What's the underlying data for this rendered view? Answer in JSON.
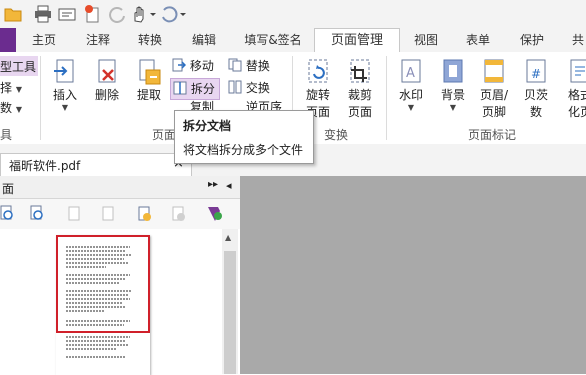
{
  "colors": {
    "accent": "#6b2c8f",
    "highlight": "#e8d6f0",
    "thumb_border": "#d0202a"
  },
  "qat": {
    "icons": [
      "folder-icon",
      "print-icon",
      "scan-icon",
      "new-icon",
      "redo-disabled-icon",
      "hand-tool-icon",
      "undo-icon"
    ]
  },
  "tabs": [
    {
      "label": "主页"
    },
    {
      "label": "注释"
    },
    {
      "label": "转换"
    },
    {
      "label": "编辑"
    },
    {
      "label": "填写&签名"
    },
    {
      "label": "页面管理"
    },
    {
      "label": "视图"
    },
    {
      "label": "表单"
    },
    {
      "label": "保护"
    },
    {
      "label": "共"
    }
  ],
  "active_tab": "页面管理",
  "left_partial": {
    "tool_label": "型工具",
    "item2": "择",
    "item3": "数",
    "group": "具"
  },
  "ribbon": {
    "insert": "插入",
    "delete": "删除",
    "extract": "提取",
    "move": "移动",
    "split": "拆分",
    "copy": "复制",
    "replace": "替换",
    "swap": "交换",
    "reverse": "逆页序",
    "rotate_line1": "旋转",
    "rotate_line2": "页面",
    "crop_line1": "裁剪",
    "crop_line2": "页面",
    "watermark": "水印",
    "background": "背景",
    "header_line1": "页眉/",
    "header_line2": "页脚",
    "bates_line1": "贝茨",
    "bates_line2": "数",
    "format_line1": "格式",
    "format_line2": "化页",
    "group_page": "页面",
    "group_transform": "变换",
    "group_marks": "页面标记"
  },
  "tooltip": {
    "title": "拆分文档",
    "desc": "将文档拆分成多个文件"
  },
  "document": {
    "tab_label": "福昕软件.pdf",
    "close": "×"
  },
  "panel": {
    "title": "面",
    "expand_glyph": "▸▸",
    "collapse_glyph": "◂"
  }
}
